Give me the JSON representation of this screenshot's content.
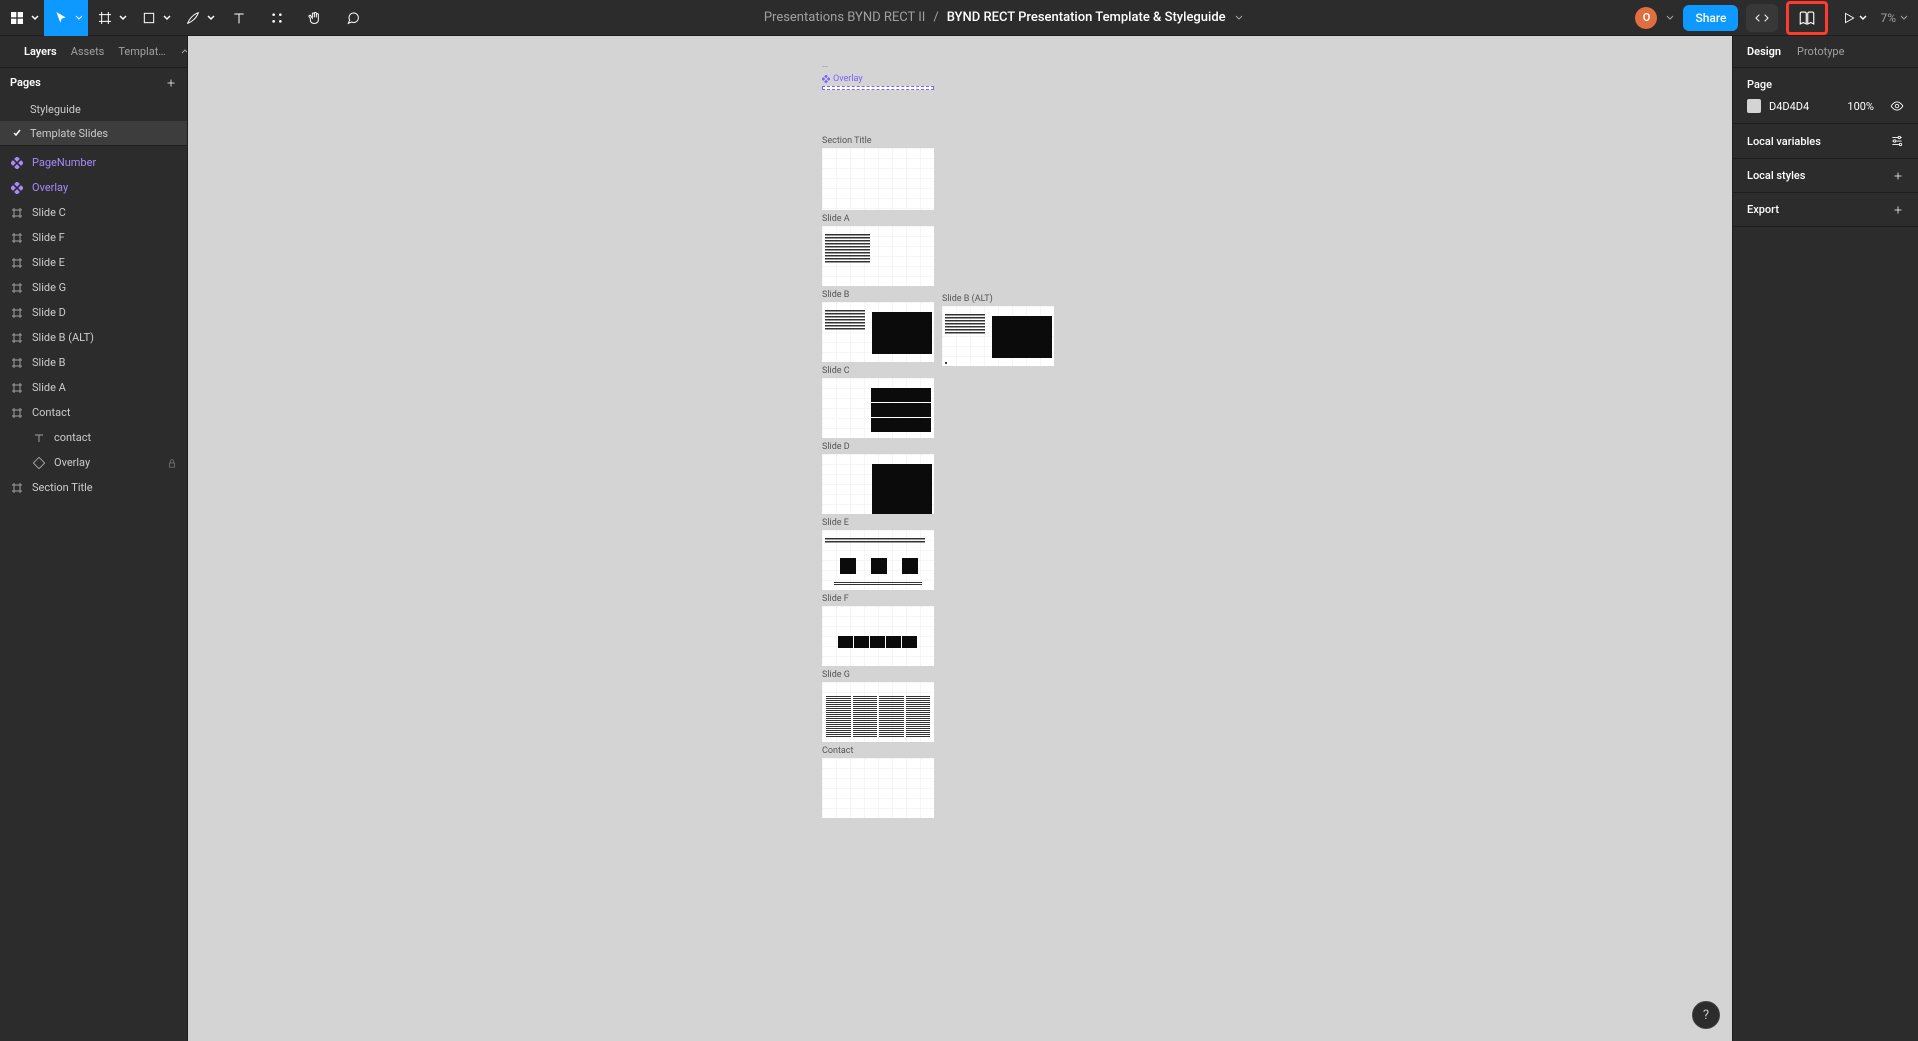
{
  "header": {
    "location": "Presentations BYND RECT II",
    "separator": "/",
    "document": "BYND RECT Presentation Template & Styleguide",
    "share": "Share",
    "zoom": "7%",
    "avatar_initial": "O"
  },
  "left_panel": {
    "tabs": [
      "Layers",
      "Assets",
      "Templat…"
    ],
    "pages_header": "Pages",
    "pages": [
      {
        "name": "Styleguide",
        "active": false
      },
      {
        "name": "Template Slides",
        "active": true
      }
    ],
    "layers": [
      {
        "name": "PageNumber",
        "icon": "component",
        "purple": true
      },
      {
        "name": "Overlay",
        "icon": "component",
        "purple": true
      },
      {
        "name": "Slide C",
        "icon": "frame"
      },
      {
        "name": "Slide F",
        "icon": "frame"
      },
      {
        "name": "Slide E",
        "icon": "frame"
      },
      {
        "name": "Slide G",
        "icon": "frame"
      },
      {
        "name": "Slide D",
        "icon": "frame"
      },
      {
        "name": "Slide B (ALT)",
        "icon": "frame"
      },
      {
        "name": "Slide B",
        "icon": "frame"
      },
      {
        "name": "Slide A",
        "icon": "frame"
      },
      {
        "name": "Contact",
        "icon": "frame"
      },
      {
        "name": "contact",
        "icon": "text",
        "indent": 1
      },
      {
        "name": "Overlay",
        "icon": "instance",
        "indent": 1,
        "locked": true
      },
      {
        "name": "Section Title",
        "icon": "frame"
      }
    ]
  },
  "canvas": {
    "overlay_label": "Overlay",
    "ellipsis": "…",
    "slides": {
      "section_title": "Section Title",
      "a": "Slide A",
      "b": "Slide B",
      "b_alt": "Slide B (ALT)",
      "c": "Slide C",
      "d": "Slide D",
      "e": "Slide E",
      "f": "Slide F",
      "g": "Slide G",
      "contact": "Contact"
    }
  },
  "right_panel": {
    "tabs": [
      "Design",
      "Prototype"
    ],
    "page_section": "Page",
    "bg_hex": "D4D4D4",
    "bg_opacity": "100%",
    "local_vars": "Local variables",
    "local_styles": "Local styles",
    "export": "Export"
  },
  "help": "?"
}
